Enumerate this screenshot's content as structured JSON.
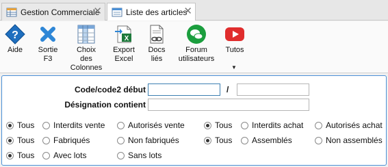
{
  "tabs": [
    {
      "label": "Gestion Commerciale",
      "close": "✕"
    },
    {
      "label": "Liste des articles",
      "close": "✕"
    }
  ],
  "ribbon": [
    {
      "id": "aide",
      "label": "Aide",
      "icon": "help-diamond-icon"
    },
    {
      "id": "sortie",
      "label": "Sortie\nF3",
      "icon": "exit-x-icon"
    },
    {
      "id": "colonnes",
      "label": "Choix\ndes\nColonnes",
      "icon": "columns-icon"
    },
    {
      "id": "export",
      "label": "Export\nExcel",
      "icon": "excel-export-icon"
    },
    {
      "id": "docs",
      "label": "Docs\nliés",
      "icon": "linked-docs-icon"
    },
    {
      "id": "forum",
      "label": "Forum\nutilisateurs",
      "icon": "forum-chat-icon"
    },
    {
      "id": "tutos",
      "label": "Tutos",
      "icon": "youtube-play-icon"
    }
  ],
  "ribbon_more": "▼",
  "filters": {
    "code_label": "Code/code2 début",
    "code_value": "",
    "code_separator": "/",
    "code2_value": "",
    "designation_label": "Désignation contient",
    "designation_value": ""
  },
  "radio_groups": [
    {
      "options": [
        "Tous",
        "Interdits vente",
        "Autorisés vente"
      ],
      "selected": 0
    },
    {
      "options": [
        "Tous",
        "Interdits achat",
        "Autorisés achat"
      ],
      "selected": 0
    },
    {
      "options": [
        "Tous",
        "Fabriqués",
        "Non fabriqués"
      ],
      "selected": 0
    },
    {
      "options": [
        "Tous",
        "Assemblés",
        "Non assemblés"
      ],
      "selected": 0
    },
    {
      "options": [
        "Tous",
        "Avec lots",
        "Sans lots"
      ],
      "selected": 0
    }
  ],
  "colors": {
    "accent": "#4a8fd6",
    "help": "#1f6fbf",
    "exit": "#2e86d6",
    "excel": "#1e7a3c",
    "forum": "#1b9e3e",
    "youtube": "#e02d2d"
  }
}
